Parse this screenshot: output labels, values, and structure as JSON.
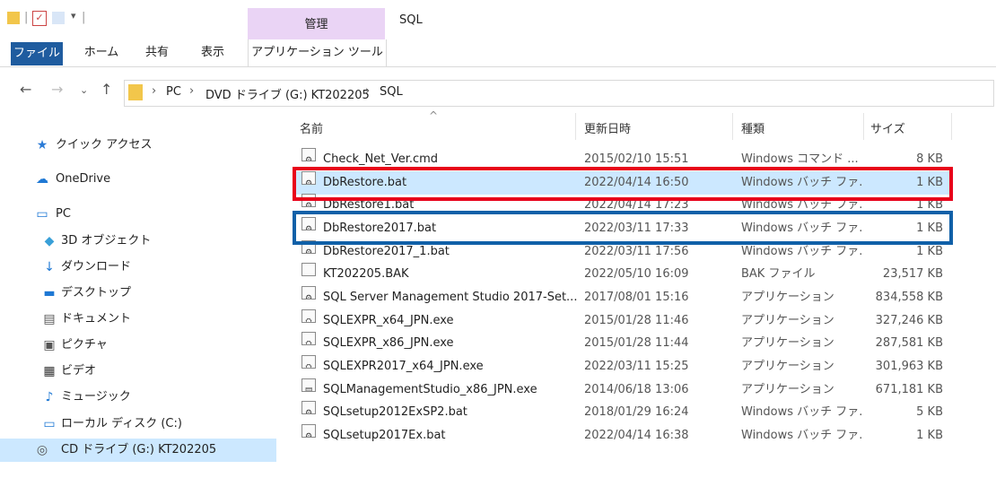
{
  "window": {
    "title": "SQL",
    "qat_separator": "|",
    "context_group": "管理"
  },
  "ribbon": {
    "tabs": [
      {
        "label": "ファイル"
      },
      {
        "label": "ホーム"
      },
      {
        "label": "共有"
      },
      {
        "label": "表示"
      },
      {
        "label": "アプリケーション ツール"
      }
    ]
  },
  "address": {
    "separator": "›",
    "crumbs": [
      "PC",
      "DVD ドライブ (G:) KT202205",
      "SQL"
    ]
  },
  "nav": {
    "items": [
      {
        "label": "クイック アクセス",
        "icon": "star-icon",
        "glyph": "★",
        "color": "#2b7bd6"
      },
      {
        "label": "OneDrive",
        "icon": "cloud-icon",
        "glyph": "☁",
        "color": "#1e78d4"
      },
      {
        "label": "PC",
        "icon": "computer-icon",
        "glyph": "▭",
        "color": "#1e78d4"
      },
      {
        "label": "3D オブジェクト",
        "icon": "cube-icon",
        "glyph": "◆",
        "color": "#39a0d8"
      },
      {
        "label": "ダウンロード",
        "icon": "download-icon",
        "glyph": "↓",
        "color": "#1e78d4"
      },
      {
        "label": "デスクトップ",
        "icon": "desktop-icon",
        "glyph": "▬",
        "color": "#1e78d4"
      },
      {
        "label": "ドキュメント",
        "icon": "document-icon",
        "glyph": "▤",
        "color": "#555555"
      },
      {
        "label": "ピクチャ",
        "icon": "picture-icon",
        "glyph": "▣",
        "color": "#555555"
      },
      {
        "label": "ビデオ",
        "icon": "video-icon",
        "glyph": "▦",
        "color": "#333333"
      },
      {
        "label": "ミュージック",
        "icon": "music-icon",
        "glyph": "♪",
        "color": "#1e78d4"
      },
      {
        "label": "ローカル ディスク (C:)",
        "icon": "disk-icon",
        "glyph": "▭",
        "color": "#1e78d4"
      },
      {
        "label": "CD ドライブ (G:) KT202205",
        "icon": "cd-icon",
        "glyph": "◎",
        "color": "#555555"
      }
    ],
    "selected_index": 11
  },
  "table": {
    "columns": [
      "名前",
      "更新日時",
      "種類",
      "サイズ"
    ],
    "sort_indicator": "^",
    "rows": [
      {
        "name": "Check_Net_Ver.cmd",
        "date": "2015/02/10 15:51",
        "type": "Windows コマンド ...",
        "size": "8 KB",
        "icon": "bat-icon",
        "glyph": "⚙"
      },
      {
        "name": "DbRestore.bat",
        "date": "2022/04/14 16:50",
        "type": "Windows バッチ ファ...",
        "size": "1 KB",
        "icon": "bat-icon",
        "glyph": "⚙"
      },
      {
        "name": "DbRestore1.bat",
        "date": "2022/04/14 17:23",
        "type": "Windows バッチ ファ...",
        "size": "1 KB",
        "icon": "bat-icon",
        "glyph": "⚙"
      },
      {
        "name": "DbRestore2017.bat",
        "date": "2022/03/11 17:33",
        "type": "Windows バッチ ファ...",
        "size": "1 KB",
        "icon": "bat-icon",
        "glyph": "⚙"
      },
      {
        "name": "DbRestore2017_1.bat",
        "date": "2022/03/11 17:56",
        "type": "Windows バッチ ファ...",
        "size": "1 KB",
        "icon": "bat-icon",
        "glyph": "⚙"
      },
      {
        "name": "KT202205.BAK",
        "date": "2022/05/10 16:09",
        "type": "BAK ファイル",
        "size": "23,517 KB",
        "icon": "file-icon",
        "glyph": ""
      },
      {
        "name": "SQL Server Management Studio 2017-Set...",
        "date": "2017/08/01 15:16",
        "type": "アプリケーション",
        "size": "834,558 KB",
        "icon": "setup-icon",
        "glyph": "⚙"
      },
      {
        "name": "SQLEXPR_x64_JPN.exe",
        "date": "2015/01/28 11:46",
        "type": "アプリケーション",
        "size": "327,246 KB",
        "icon": "installer-icon",
        "glyph": "⛭"
      },
      {
        "name": "SQLEXPR_x86_JPN.exe",
        "date": "2015/01/28 11:44",
        "type": "アプリケーション",
        "size": "287,581 KB",
        "icon": "installer-icon",
        "glyph": "⛭"
      },
      {
        "name": "SQLEXPR2017_x64_JPN.exe",
        "date": "2022/03/11 15:25",
        "type": "アプリケーション",
        "size": "301,963 KB",
        "icon": "installer-icon",
        "glyph": "⛭"
      },
      {
        "name": "SQLManagementStudio_x86_JPN.exe",
        "date": "2014/06/18 13:06",
        "type": "アプリケーション",
        "size": "671,181 KB",
        "icon": "app-icon",
        "glyph": "▤"
      },
      {
        "name": "SQLsetup2012ExSP2.bat",
        "date": "2018/01/29 16:24",
        "type": "Windows バッチ ファ...",
        "size": "5 KB",
        "icon": "bat-icon",
        "glyph": "⚙"
      },
      {
        "name": "SQLsetup2017Ex.bat",
        "date": "2022/04/14 16:38",
        "type": "Windows バッチ ファ...",
        "size": "1 KB",
        "icon": "bat-icon",
        "glyph": "⚙"
      }
    ],
    "selected_index": 1
  },
  "colors": {
    "file_tab": "#1f5c9f",
    "context_group": "#ead4f5",
    "selection": "#cce8ff",
    "highlight_red": "#e8001a",
    "highlight_blue": "#1060a8"
  }
}
